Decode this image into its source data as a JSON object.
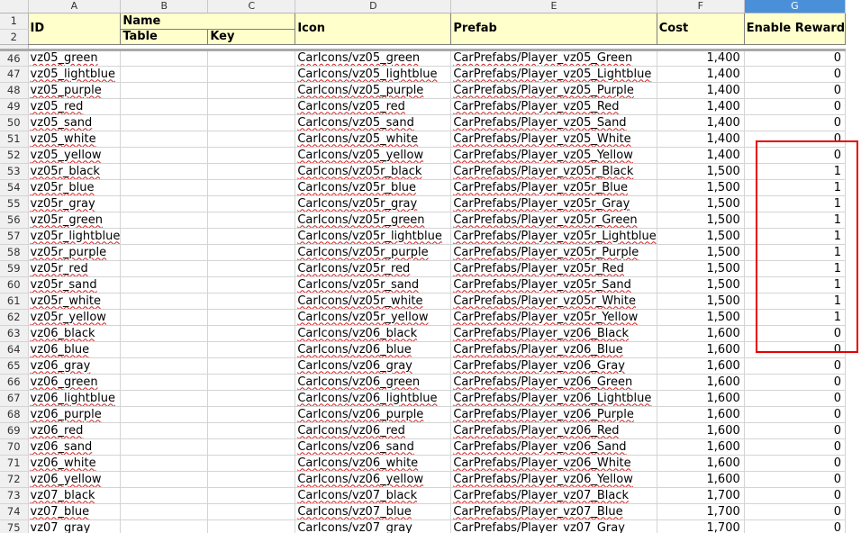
{
  "columns": {
    "letters": [
      "A",
      "B",
      "C",
      "D",
      "E",
      "F",
      "G"
    ],
    "selected": "G"
  },
  "header": {
    "row_numbers": [
      "1",
      "2"
    ],
    "id": "ID",
    "name": "Name",
    "table": "Table",
    "key": "Key",
    "icon": "Icon",
    "prefab": "Prefab",
    "cost": "Cost",
    "enable_reward": "Enable Reward"
  },
  "rows": [
    {
      "n": "46",
      "id": "vz05_green",
      "icon": "CarIcons/vz05_green",
      "prefab": "CarPrefabs/Player_vz05_Green",
      "cost": "1,400",
      "reward": "0"
    },
    {
      "n": "47",
      "id": "vz05_lightblue",
      "icon": "CarIcons/vz05_lightblue",
      "prefab": "CarPrefabs/Player_vz05_Lightblue",
      "cost": "1,400",
      "reward": "0"
    },
    {
      "n": "48",
      "id": "vz05_purple",
      "icon": "CarIcons/vz05_purple",
      "prefab": "CarPrefabs/Player_vz05_Purple",
      "cost": "1,400",
      "reward": "0"
    },
    {
      "n": "49",
      "id": "vz05_red",
      "icon": "CarIcons/vz05_red",
      "prefab": "CarPrefabs/Player_vz05_Red",
      "cost": "1,400",
      "reward": "0"
    },
    {
      "n": "50",
      "id": "vz05_sand",
      "icon": "CarIcons/vz05_sand",
      "prefab": "CarPrefabs/Player_vz05_Sand",
      "cost": "1,400",
      "reward": "0"
    },
    {
      "n": "51",
      "id": "vz05_white",
      "icon": "CarIcons/vz05_white",
      "prefab": "CarPrefabs/Player_vz05_White",
      "cost": "1,400",
      "reward": "0"
    },
    {
      "n": "52",
      "id": "vz05_yellow",
      "icon": "CarIcons/vz05_yellow",
      "prefab": "CarPrefabs/Player_vz05_Yellow",
      "cost": "1,400",
      "reward": "0"
    },
    {
      "n": "53",
      "id": "vz05r_black",
      "icon": "CarIcons/vz05r_black",
      "prefab": "CarPrefabs/Player_vz05r_Black",
      "cost": "1,500",
      "reward": "1"
    },
    {
      "n": "54",
      "id": "vz05r_blue",
      "icon": "CarIcons/vz05r_blue",
      "prefab": "CarPrefabs/Player_vz05r_Blue",
      "cost": "1,500",
      "reward": "1"
    },
    {
      "n": "55",
      "id": "vz05r_gray",
      "icon": "CarIcons/vz05r_gray",
      "prefab": "CarPrefabs/Player_vz05r_Gray",
      "cost": "1,500",
      "reward": "1"
    },
    {
      "n": "56",
      "id": "vz05r_green",
      "icon": "CarIcons/vz05r_green",
      "prefab": "CarPrefabs/Player_vz05r_Green",
      "cost": "1,500",
      "reward": "1"
    },
    {
      "n": "57",
      "id": "vz05r_lightblue",
      "icon": "CarIcons/vz05r_lightblue",
      "prefab": "CarPrefabs/Player_vz05r_Lightblue",
      "cost": "1,500",
      "reward": "1"
    },
    {
      "n": "58",
      "id": "vz05r_purple",
      "icon": "CarIcons/vz05r_purple",
      "prefab": "CarPrefabs/Player_vz05r_Purple",
      "cost": "1,500",
      "reward": "1"
    },
    {
      "n": "59",
      "id": "vz05r_red",
      "icon": "CarIcons/vz05r_red",
      "prefab": "CarPrefabs/Player_vz05r_Red",
      "cost": "1,500",
      "reward": "1"
    },
    {
      "n": "60",
      "id": "vz05r_sand",
      "icon": "CarIcons/vz05r_sand",
      "prefab": "CarPrefabs/Player_vz05r_Sand",
      "cost": "1,500",
      "reward": "1"
    },
    {
      "n": "61",
      "id": "vz05r_white",
      "icon": "CarIcons/vz05r_white",
      "prefab": "CarPrefabs/Player_vz05r_White",
      "cost": "1,500",
      "reward": "1"
    },
    {
      "n": "62",
      "id": "vz05r_yellow",
      "icon": "CarIcons/vz05r_yellow",
      "prefab": "CarPrefabs/Player_vz05r_Yellow",
      "cost": "1,500",
      "reward": "1"
    },
    {
      "n": "63",
      "id": "vz06_black",
      "icon": "CarIcons/vz06_black",
      "prefab": "CarPrefabs/Player_vz06_Black",
      "cost": "1,600",
      "reward": "0"
    },
    {
      "n": "64",
      "id": "vz06_blue",
      "icon": "CarIcons/vz06_blue",
      "prefab": "CarPrefabs/Player_vz06_Blue",
      "cost": "1,600",
      "reward": "0"
    },
    {
      "n": "65",
      "id": "vz06_gray",
      "icon": "CarIcons/vz06_gray",
      "prefab": "CarPrefabs/Player_vz06_Gray",
      "cost": "1,600",
      "reward": "0"
    },
    {
      "n": "66",
      "id": "vz06_green",
      "icon": "CarIcons/vz06_green",
      "prefab": "CarPrefabs/Player_vz06_Green",
      "cost": "1,600",
      "reward": "0"
    },
    {
      "n": "67",
      "id": "vz06_lightblue",
      "icon": "CarIcons/vz06_lightblue",
      "prefab": "CarPrefabs/Player_vz06_Lightblue",
      "cost": "1,600",
      "reward": "0"
    },
    {
      "n": "68",
      "id": "vz06_purple",
      "icon": "CarIcons/vz06_purple",
      "prefab": "CarPrefabs/Player_vz06_Purple",
      "cost": "1,600",
      "reward": "0"
    },
    {
      "n": "69",
      "id": "vz06_red",
      "icon": "CarIcons/vz06_red",
      "prefab": "CarPrefabs/Player_vz06_Red",
      "cost": "1,600",
      "reward": "0"
    },
    {
      "n": "70",
      "id": "vz06_sand",
      "icon": "CarIcons/vz06_sand",
      "prefab": "CarPrefabs/Player_vz06_Sand",
      "cost": "1,600",
      "reward": "0"
    },
    {
      "n": "71",
      "id": "vz06_white",
      "icon": "CarIcons/vz06_white",
      "prefab": "CarPrefabs/Player_vz06_White",
      "cost": "1,600",
      "reward": "0"
    },
    {
      "n": "72",
      "id": "vz06_yellow",
      "icon": "CarIcons/vz06_yellow",
      "prefab": "CarPrefabs/Player_vz06_Yellow",
      "cost": "1,600",
      "reward": "0"
    },
    {
      "n": "73",
      "id": "vz07_black",
      "icon": "CarIcons/vz07_black",
      "prefab": "CarPrefabs/Player_vz07_Black",
      "cost": "1,700",
      "reward": "0"
    },
    {
      "n": "74",
      "id": "vz07_blue",
      "icon": "CarIcons/vz07_blue",
      "prefab": "CarPrefabs/Player_vz07_Blue",
      "cost": "1,700",
      "reward": "0"
    },
    {
      "n": "75",
      "id": "vz07_gray",
      "icon": "CarIcons/vz07_gray",
      "prefab": "CarPrefabs/Player_vz07_Gray",
      "cost": "1,700",
      "reward": "0"
    }
  ],
  "highlight_color": "#e60000"
}
